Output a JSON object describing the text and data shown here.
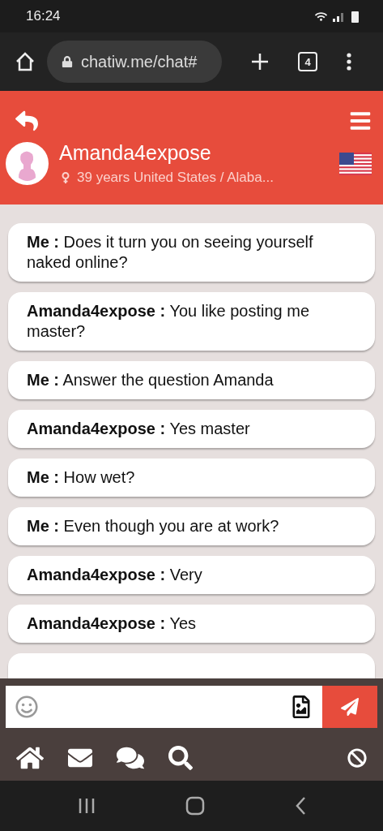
{
  "status_bar": {
    "time": "16:24"
  },
  "browser": {
    "url": "chatiw.me/chat#",
    "tab_count": "4"
  },
  "profile": {
    "name": "Amanda4expose",
    "details": "39 years United States / Alaba..."
  },
  "messages": [
    {
      "sender": "Me :",
      "text": "Does it turn you on seeing yourself naked online?"
    },
    {
      "sender": "Amanda4expose :",
      "text": "You like posting me master?"
    },
    {
      "sender": "Me :",
      "text": "Answer the question Amanda"
    },
    {
      "sender": "Amanda4expose :",
      "text": "Yes master"
    },
    {
      "sender": "Me :",
      "text": "How wet?"
    },
    {
      "sender": "Me :",
      "text": "Even though you are at work?"
    },
    {
      "sender": "Amanda4expose :",
      "text": "Very"
    },
    {
      "sender": "Amanda4expose :",
      "text": "Yes"
    }
  ]
}
